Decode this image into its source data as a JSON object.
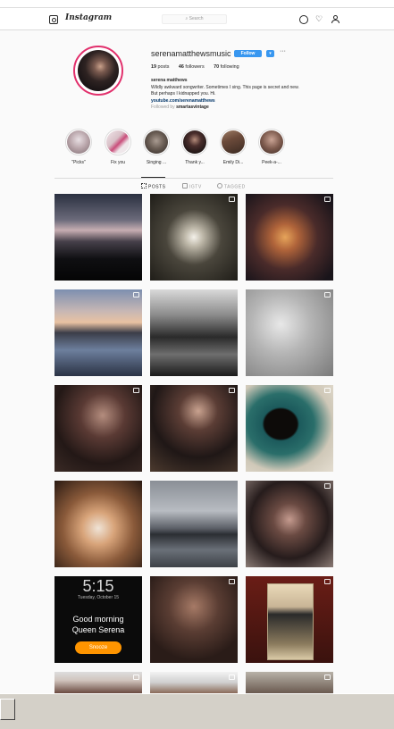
{
  "header": {
    "brand": "Instagram",
    "search_placeholder": "Search"
  },
  "profile": {
    "username": "serenamatthewsmusic",
    "follow_label": "Follow",
    "dropdown_label": "▾",
    "more_label": "···",
    "posts_count": "19",
    "posts_label": "posts",
    "followers_count": "46",
    "followers_label": "followers",
    "following_count": "70",
    "following_label": "following",
    "full_name": "serena matthews",
    "bio_line1": "Wildly awkward songwriter. Sometimes I sing. This page is secret and new.",
    "bio_line2": "But perhaps I kidnapped you. Hi.",
    "website": "youtube.com/serenamatthews",
    "followed_by_prefix": "Followed by",
    "followed_by_user": "smartasvintage"
  },
  "highlights": [
    {
      "label": "\"Picks\"",
      "color": "#b7a3a8"
    },
    {
      "label": "Fix you",
      "color": "#d8c0c7"
    },
    {
      "label": "Singing ...",
      "color": "#6b5e55"
    },
    {
      "label": "Thank y...",
      "color": "#2b1d1d"
    },
    {
      "label": "Emily Di...",
      "color": "#6b4a3a"
    },
    {
      "label": "Peek-a-...",
      "color": "#7d5a4d"
    }
  ],
  "tabs": [
    {
      "label": "POSTS",
      "active": true
    },
    {
      "label": "IGTV",
      "active": false
    },
    {
      "label": "TAGGED",
      "active": false
    }
  ],
  "lockscreen": {
    "time": "5:15",
    "date": "Tuesday, October 15",
    "greeting_line1": "Good morning",
    "greeting_line2": "Queen Serena",
    "button_label": "Snooze"
  },
  "colors": {
    "accent": "#3897f0",
    "story_ring": "#e1306c",
    "snooze": "#ff9500"
  }
}
